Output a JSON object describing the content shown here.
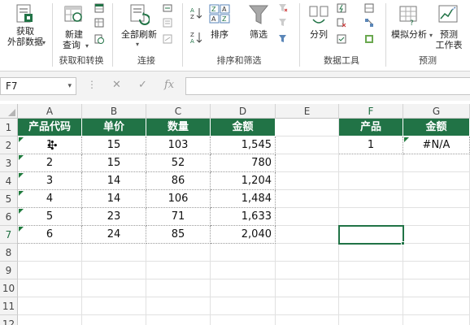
{
  "ribbon": {
    "get_external_data": {
      "line1": "获取",
      "line2": "外部数据"
    },
    "new_query": {
      "line1": "新建",
      "line2": "查询"
    },
    "group_get_transform": "获取和转换",
    "refresh_all": "全部刷新",
    "group_connections": "连接",
    "sort": "排序",
    "filter": "筛选",
    "group_sort_filter": "排序和筛选",
    "text_to_columns": "分列",
    "group_data_tools": "数据工具",
    "what_if": "模拟分析",
    "forecast_sheet": {
      "line1": "预测",
      "line2": "工作表"
    },
    "group_forecast": "预测",
    "colors": {
      "accent": "#217346"
    }
  },
  "formula_bar": {
    "name_box": "F7",
    "cancel_icon": "✕",
    "enter_icon": "✓",
    "fx_icon": "fx",
    "formula": ""
  },
  "sheet": {
    "columns": [
      "A",
      "B",
      "C",
      "D",
      "E",
      "F",
      "G"
    ],
    "rows": [
      "1",
      "2",
      "3",
      "4",
      "5",
      "6",
      "7",
      "8",
      "9",
      "10",
      "11",
      "12"
    ],
    "table_headers": [
      "产品代码",
      "单价",
      "数量",
      "金额"
    ],
    "table_rows": [
      [
        "1",
        "15",
        "103",
        "1,545"
      ],
      [
        "2",
        "15",
        "52",
        "780"
      ],
      [
        "3",
        "14",
        "86",
        "1,204"
      ],
      [
        "4",
        "14",
        "106",
        "1,484"
      ],
      [
        "5",
        "23",
        "71",
        "1,633"
      ],
      [
        "6",
        "24",
        "85",
        "2,040"
      ]
    ],
    "lookup_headers": [
      "产品",
      "金额"
    ],
    "lookup_row": [
      "1",
      "#N/A"
    ],
    "selected_cell": "F7",
    "header_fill": "#217346"
  }
}
